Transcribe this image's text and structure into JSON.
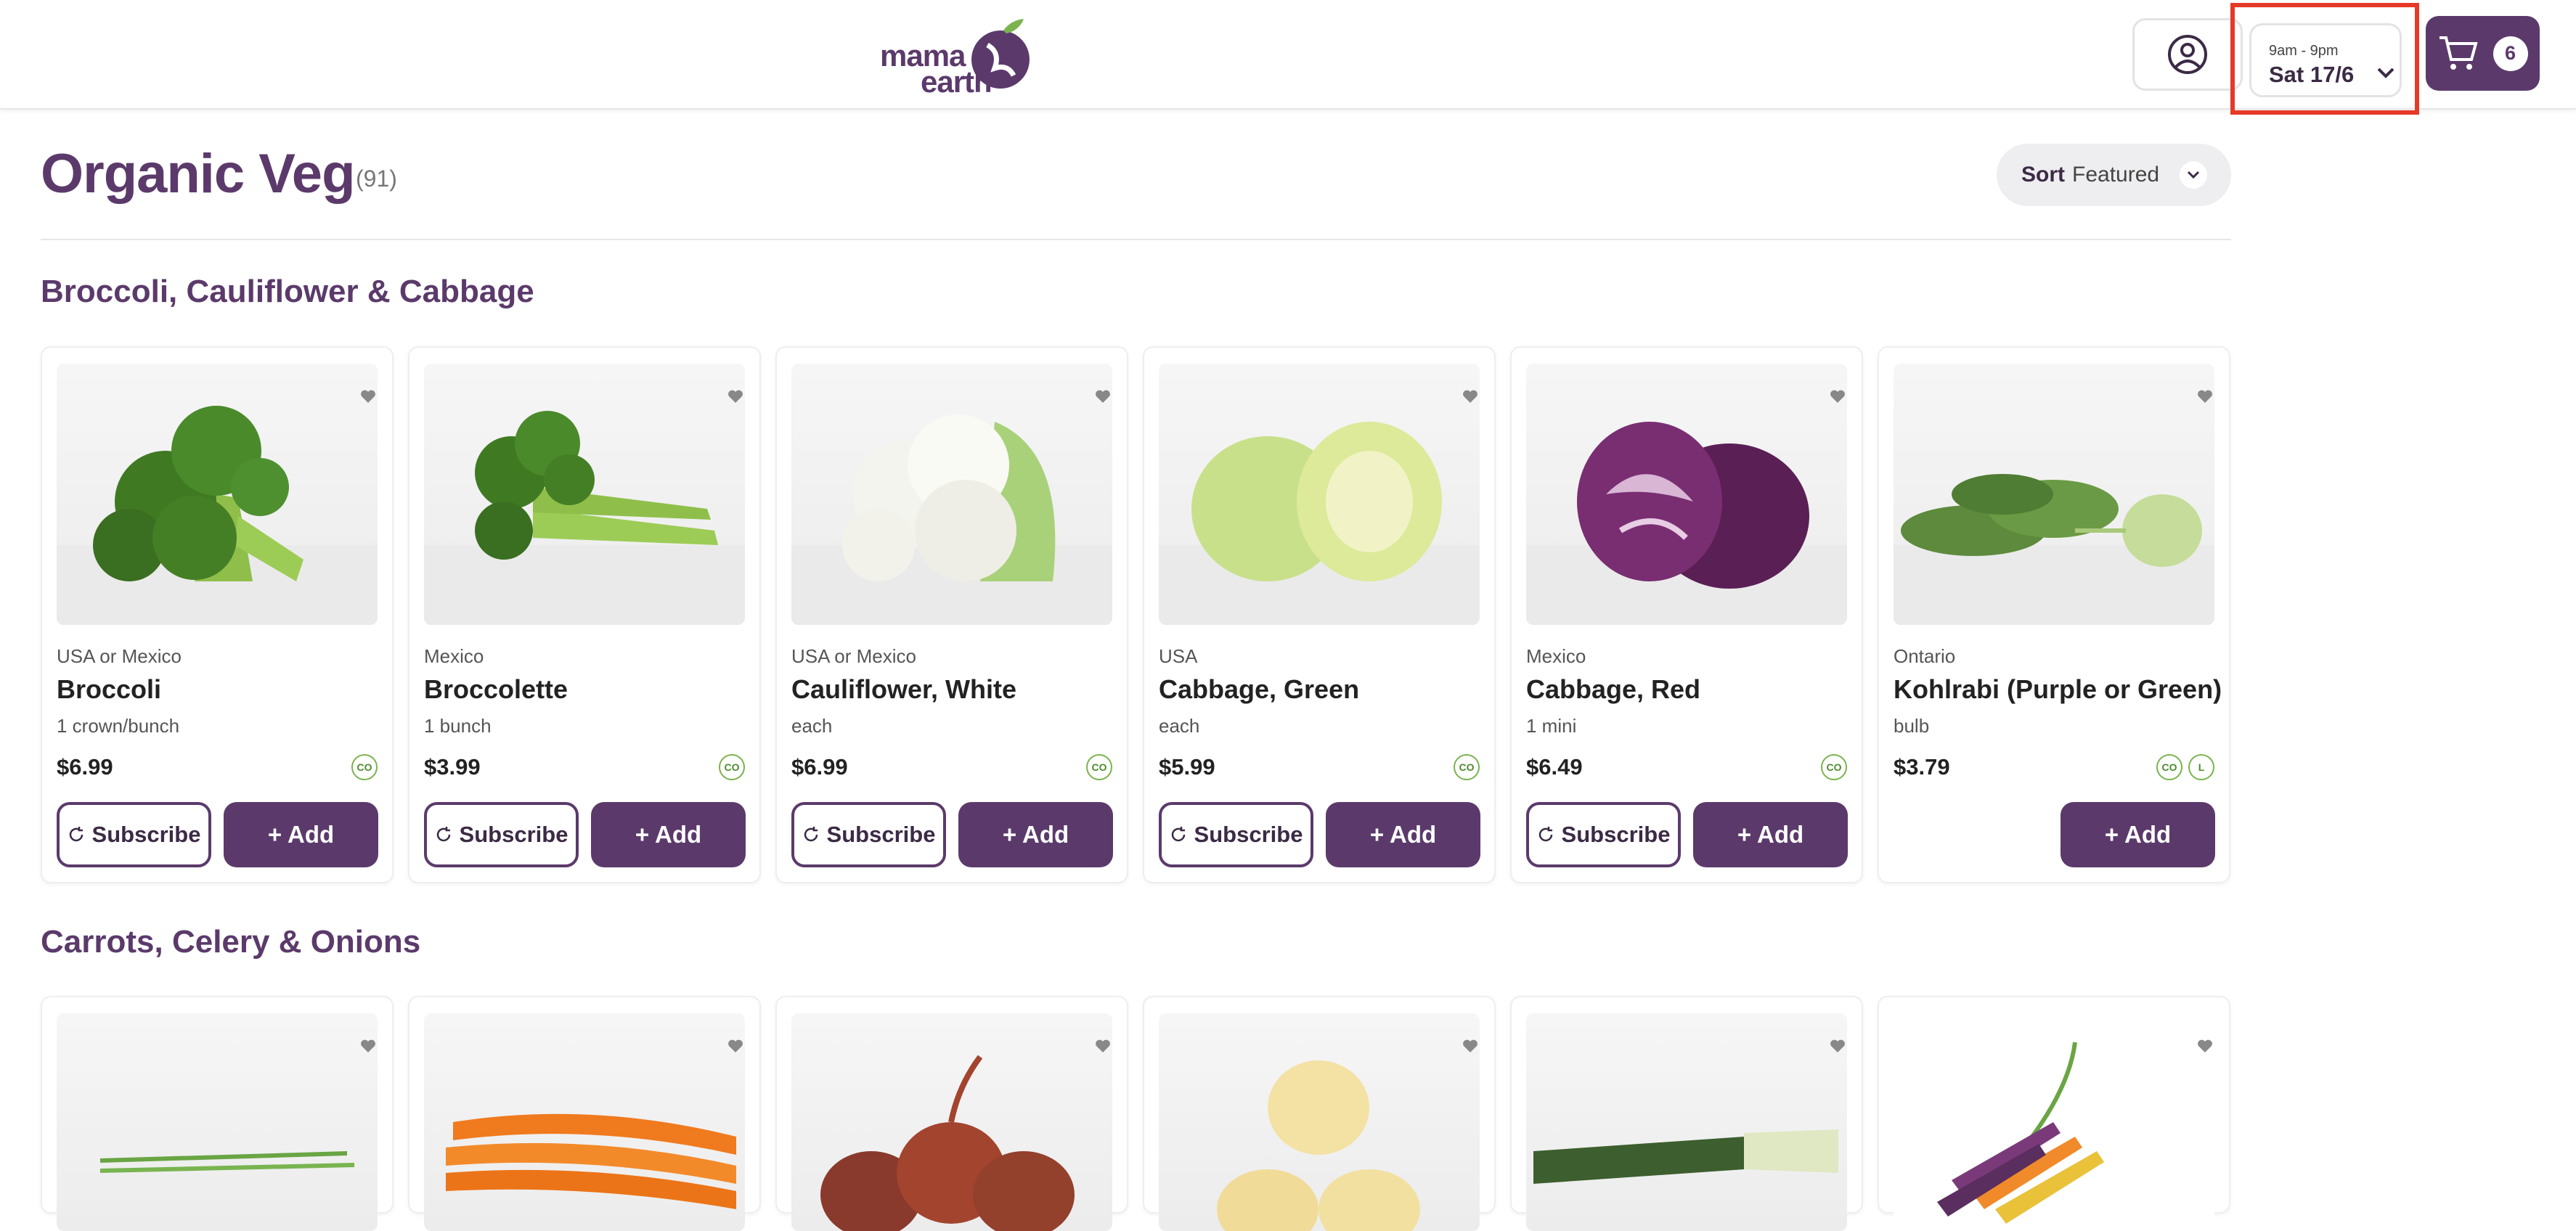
{
  "header": {
    "logo": {
      "line1": "mama",
      "line2": "earth"
    },
    "delivery": {
      "hours": "9am - 9pm",
      "day": "Sat 17/6"
    },
    "cart_count": "6",
    "icons": {
      "account": "user-circle-icon",
      "cart": "cart-icon",
      "chevron": "chevron-down-icon"
    }
  },
  "page": {
    "title": "Organic Veg",
    "count": "(91)"
  },
  "sort": {
    "label": "Sort",
    "value": "Featured"
  },
  "categories": [
    {
      "title": "Broccoli, Cauliflower & Cabbage"
    },
    {
      "title": "Carrots, Celery & Onions"
    }
  ],
  "products": [
    {
      "origin": "USA or Mexico",
      "name": "Broccoli",
      "unit": "1 crown/bunch",
      "price": "$6.99",
      "badges": [
        "CO"
      ],
      "subscribe": "Subscribe",
      "add": "+ Add"
    },
    {
      "origin": "Mexico",
      "name": "Broccolette",
      "unit": "1 bunch",
      "price": "$3.99",
      "badges": [
        "CO"
      ],
      "subscribe": "Subscribe",
      "add": "+ Add"
    },
    {
      "origin": "USA or Mexico",
      "name": "Cauliflower, White",
      "unit": "each",
      "price": "$6.99",
      "badges": [
        "CO"
      ],
      "subscribe": "Subscribe",
      "add": "+ Add"
    },
    {
      "origin": "USA",
      "name": "Cabbage, Green",
      "unit": "each",
      "price": "$5.99",
      "badges": [
        "CO"
      ],
      "subscribe": "Subscribe",
      "add": "+ Add"
    },
    {
      "origin": "Mexico",
      "name": "Cabbage, Red",
      "unit": "1 mini",
      "price": "$6.49",
      "badges": [
        "CO"
      ],
      "subscribe": "Subscribe",
      "add": "+ Add"
    },
    {
      "origin": "Ontario",
      "name": "Kohlrabi (Purple or Green)",
      "unit": "bulb",
      "price": "$3.79",
      "badges": [
        "CO",
        "L"
      ],
      "add": "+ Add"
    }
  ],
  "colors": {
    "brand": "#5b3a6b",
    "highlight": "#e53a28",
    "badge": "#7bb34e"
  }
}
